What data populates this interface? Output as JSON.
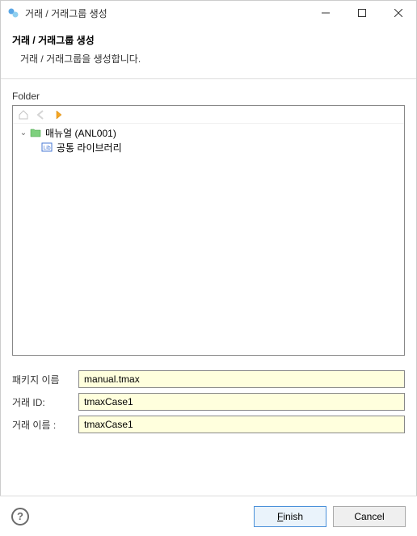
{
  "window": {
    "title": "거래 / 거래그룹 생성"
  },
  "header": {
    "title": "거래 / 거래그룹 생성",
    "description": "거래 / 거래그룹을 생성합니다."
  },
  "folder": {
    "label": "Folder",
    "tree": {
      "root": {
        "label": "매뉴얼 (ANL001)",
        "expanded": true,
        "children": [
          {
            "label": "공통 라이브러리",
            "icon": "lib"
          }
        ]
      }
    }
  },
  "form": {
    "package_label": "패키지 이름",
    "package_value": "manual.tmax",
    "txid_label": "거래 ID:",
    "txid_value": "tmaxCase1",
    "txname_label": "거래 이름 :",
    "txname_value": "tmaxCase1"
  },
  "footer": {
    "finish_label": "Finish",
    "cancel_label": "Cancel"
  }
}
